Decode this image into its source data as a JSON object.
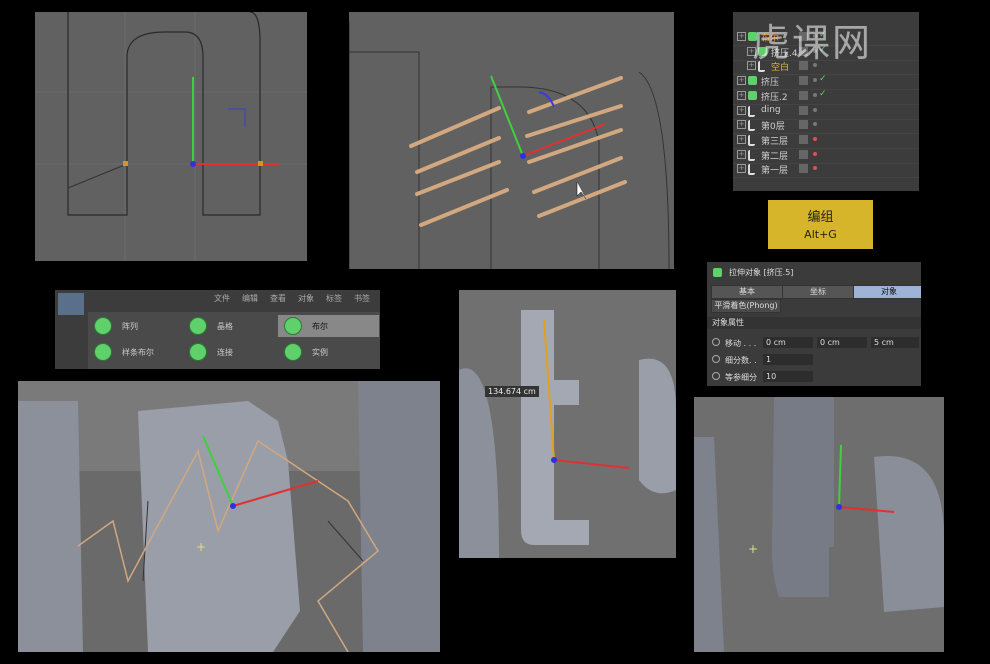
{
  "watermark": "虎课网",
  "object_manager": {
    "items": [
      {
        "label": "布尔",
        "color": "#e08a2a",
        "type": "boole"
      },
      {
        "label": "挤压.4",
        "type": "extrude"
      },
      {
        "label": "空白",
        "color": "#e0c030",
        "type": "null"
      },
      {
        "label": "挤压",
        "type": "extrude"
      },
      {
        "label": "挤压.2",
        "type": "extrude"
      },
      {
        "label": "ding",
        "type": "null"
      },
      {
        "label": "第0层",
        "type": "null"
      },
      {
        "label": "第三层",
        "type": "null"
      },
      {
        "label": "第二层",
        "type": "null"
      },
      {
        "label": "第一层",
        "type": "null"
      }
    ]
  },
  "shortcut_badge": {
    "title": "编组",
    "shortcut": "Alt+G",
    "color": "#d7b52b"
  },
  "attributes": {
    "title": "拉伸对象 [挤压.5]",
    "tabs": [
      "基本",
      "坐标",
      "对象"
    ],
    "active_tab": "对象",
    "phong_button": "平滑着色(Phong)",
    "section": "对象属性",
    "move_label": "移动 . . .",
    "move": [
      "0 cm",
      "0 cm",
      "5 cm"
    ],
    "subdiv_label": "细分数. .",
    "subdiv": "1",
    "isoparm_label": "等参细分",
    "isoparm": "10"
  },
  "toolbar": {
    "menu": [
      "文件",
      "编辑",
      "查看",
      "对象",
      "标签",
      "书签"
    ],
    "items": [
      "阵列",
      "晶格",
      "布尔",
      "样条布尔",
      "连接",
      "实例"
    ]
  },
  "viewport_measure": "134.674 cm"
}
